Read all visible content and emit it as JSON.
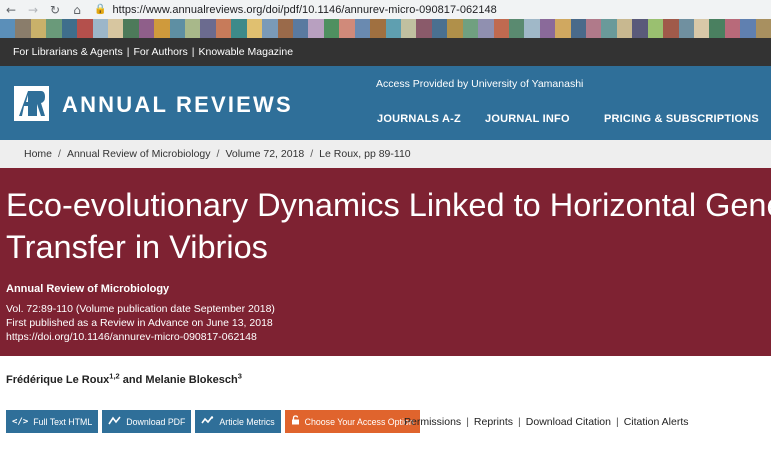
{
  "browser": {
    "url": "https://www.annualreviews.org/doi/pdf/10.1146/annurev-micro-090817-062148",
    "icons": [
      "back-arrow-icon",
      "forward-arrow-icon",
      "reload-icon",
      "home-icon",
      "lock-icon"
    ]
  },
  "stripe_colors": [
    "#5b8fb9",
    "#8a7d6b",
    "#c9b16a",
    "#6a9a7a",
    "#3f6e8c",
    "#b4504c",
    "#9cb6c9",
    "#d7c6a0",
    "#4d7a5a",
    "#8f5f8a",
    "#cf9a3c",
    "#5e8fa3",
    "#a8b88a",
    "#6b6b8f",
    "#c77b5a",
    "#3d8a8a",
    "#e0c070",
    "#7a9ab8",
    "#9a6a4a",
    "#5a7aa0",
    "#b8a0c0",
    "#4f9060",
    "#d08a7a",
    "#6a8ab0",
    "#a07040",
    "#5f9fb0",
    "#c0c0a0",
    "#8a5a6a",
    "#4a7090",
    "#b0904a",
    "#70a080",
    "#9090b0",
    "#c06a50",
    "#5a8a70",
    "#a0b8c8",
    "#8a6a9a",
    "#d0a860",
    "#4a6a8a",
    "#b07a8a",
    "#6a9a9a",
    "#c8b890",
    "#5a5a7a",
    "#9ac070",
    "#a05a4a",
    "#7090a0",
    "#d8c8a8",
    "#4a8060",
    "#b86a7a",
    "#6080b0",
    "#a89060"
  ],
  "top_links": [
    "For Librarians & Agents",
    "For Authors",
    "Knowable Magazine"
  ],
  "header": {
    "logo_text": "ANNUAL REVIEWS",
    "access": "Access Provided by University of Yamanashi",
    "nav": [
      "JOURNALS A-Z",
      "JOURNAL INFO",
      "PRICING & SUBSCRIPTIONS"
    ],
    "colors": {
      "header_bg": "#2f6f99",
      "top_bar_bg": "#333333"
    }
  },
  "breadcrumb": [
    "Home",
    "Annual Review of Microbiology",
    "Volume 72, 2018",
    "Le Roux, pp 89-110"
  ],
  "article": {
    "title_line1": "Eco-evolutionary Dynamics Linked to Horizontal Gene",
    "title_line2": "Transfer in Vibrios",
    "journal": "Annual Review of Microbiology",
    "volume_line": "Vol. 72:89-110 (Volume publication date September 2018)",
    "published_line": "First published as a Review in Advance on June 13, 2018",
    "doi_line": "https://doi.org/10.1146/annurev-micro-090817-062148",
    "hero_color": "#7e2232"
  },
  "authors": {
    "author1": "Frédérique Le Roux",
    "author1_sup": "1,2",
    "joiner": " and ",
    "author2": "Melanie Blokesch",
    "author2_sup": "3"
  },
  "actions": {
    "full_text": "Full Text HTML",
    "download_pdf": "Download PDF",
    "article_metrics": "Article Metrics",
    "access_option": "Choose Your Access Option",
    "colors": {
      "primary": "#2f6f99",
      "accent": "#e0642d"
    }
  },
  "tool_links": [
    "Permissions",
    "Reprints",
    "Download Citation",
    "Citation Alerts"
  ]
}
